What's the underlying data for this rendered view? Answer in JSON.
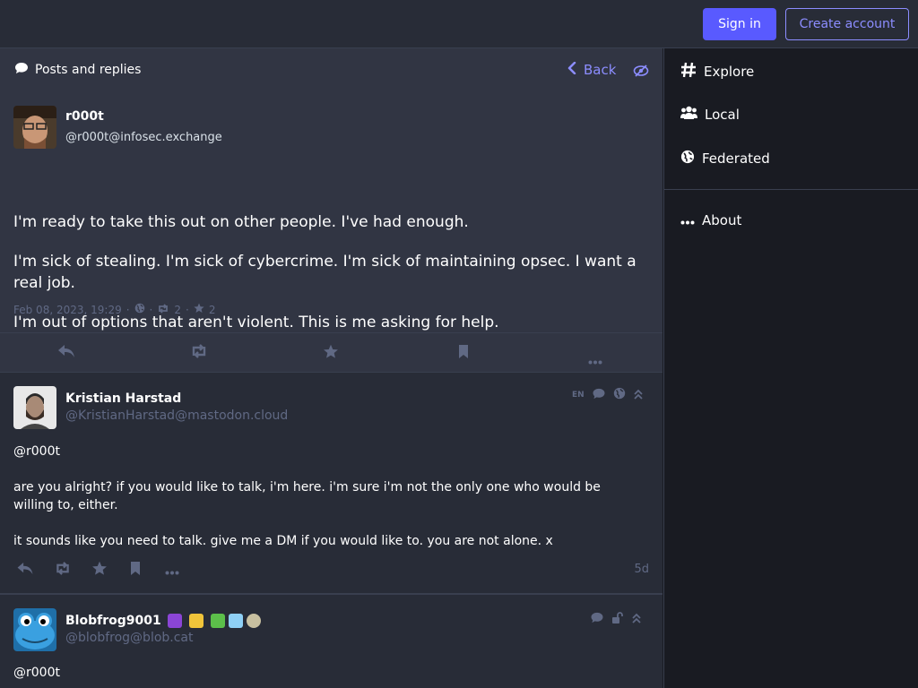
{
  "topbar": {
    "signin_label": "Sign in",
    "create_label": "Create account"
  },
  "column": {
    "title": "Posts and replies",
    "back_label": "Back"
  },
  "focal_post": {
    "display_name": "r000t",
    "acct": "@r000t@infosec.exchange",
    "paragraphs": [
      "I'm ready to take this out on other people. I've had enough.",
      "I'm sick of stealing. I'm sick of cybercrime. I'm sick of maintaining opsec. I want a real job.",
      "I'm out of options that aren't violent. This is me asking for help."
    ],
    "date": "Feb 08, 2023, 19:29",
    "boosts": "2",
    "favourites": "2"
  },
  "replies": [
    {
      "display_name": "Kristian Harstad",
      "acct": "@KristianHarstad@mastodon.cloud",
      "language": "EN",
      "mention": "@r000t",
      "paragraphs": [
        "are you alright? if you would like to talk, i'm here. i'm sure i'm not the only one who would be willing to, either.",
        "it sounds like you need to talk. give me a DM if you would like to. you are not alone. x"
      ],
      "time": "5d"
    },
    {
      "display_name": "Blobfrog9001",
      "acct": "@blobfrog@blob.cat",
      "mention": "@r000t"
    }
  ],
  "sidebar": {
    "explore": "Explore",
    "local": "Local",
    "federated": "Federated",
    "about": "About"
  },
  "colors": {
    "accent": "#595aff",
    "accent_light": "#8c8dff",
    "background": "#191b22",
    "surface": "#282c37",
    "muted": "#606984"
  },
  "icons": [
    "comment-icon",
    "chevron-left-icon",
    "eye-slash-icon",
    "globe-icon",
    "retweet-icon",
    "star-icon",
    "reply-icon",
    "bookmark-icon",
    "ellipsis-icon",
    "hashtag-icon",
    "users-icon",
    "lock-open-icon",
    "chevron-up-icon"
  ]
}
